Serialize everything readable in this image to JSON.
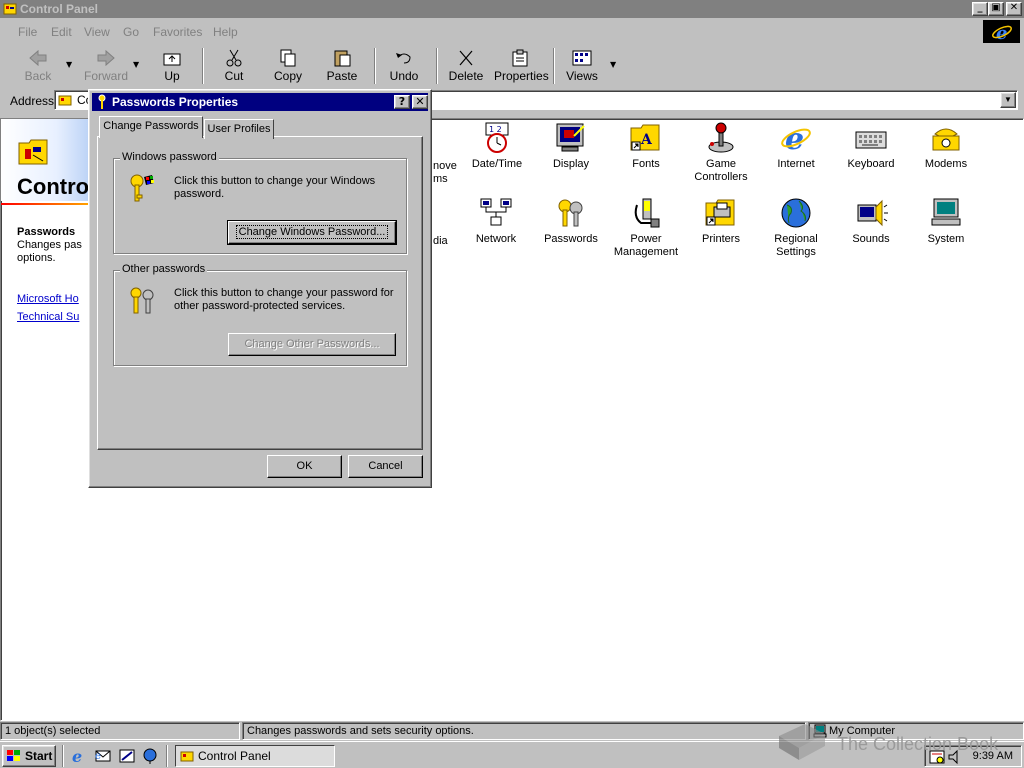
{
  "window": {
    "title": "Control Panel",
    "buttons": {
      "minimize": "_",
      "restore": "▣",
      "close": "✕"
    }
  },
  "menu": [
    {
      "label": "File"
    },
    {
      "label": "Edit"
    },
    {
      "label": "View"
    },
    {
      "label": "Go"
    },
    {
      "label": "Favorites"
    },
    {
      "label": "Help"
    }
  ],
  "toolbar": {
    "back": "Back",
    "forward": "Forward",
    "up": "Up",
    "cut": "Cut",
    "copy": "Copy",
    "paste": "Paste",
    "undo": "Undo",
    "delete": "Delete",
    "properties": "Properties",
    "views": "Views"
  },
  "address": {
    "label": "Address",
    "value": "Co"
  },
  "left_panel": {
    "title": "Contro",
    "item_title": "Passwords",
    "item_desc": "Changes pas options.",
    "link1": "Microsoft Ho",
    "link2": "Technical Su"
  },
  "partial_labels": [
    "nove",
    "ms",
    "dia"
  ],
  "icons": [
    {
      "label": "Date/Time"
    },
    {
      "label": "Display"
    },
    {
      "label": "Fonts"
    },
    {
      "label": "Game Controllers"
    },
    {
      "label": "Internet"
    },
    {
      "label": "Keyboard"
    },
    {
      "label": "Modems"
    },
    {
      "label": "Network"
    },
    {
      "label": "Passwords"
    },
    {
      "label": "Power Management"
    },
    {
      "label": "Printers"
    },
    {
      "label": "Regional Settings"
    },
    {
      "label": "Sounds"
    },
    {
      "label": "System"
    }
  ],
  "dialog": {
    "title": "Passwords Properties",
    "help_btn": "?",
    "close_btn": "✕",
    "tabs": [
      "Change Passwords",
      "User Profiles"
    ],
    "group1": {
      "legend": "Windows password",
      "text": "Click this button to change your Windows password.",
      "button": "Change Windows Password..."
    },
    "group2": {
      "legend": "Other passwords",
      "text": "Click this button to change your password for other password-protected services.",
      "button": "Change Other Passwords..."
    },
    "ok": "OK",
    "cancel": "Cancel"
  },
  "status": {
    "left": "1 object(s) selected",
    "middle": "Changes passwords and sets security options.",
    "right": "My Computer"
  },
  "taskbar": {
    "start": "Start",
    "task": "Control Panel",
    "clock": "9:39 AM"
  },
  "watermark": "The Collection Book",
  "colors": {
    "face": "#c0c0c0",
    "title_active": "#000080",
    "title_inactive": "#808080",
    "link": "#0000cc"
  }
}
